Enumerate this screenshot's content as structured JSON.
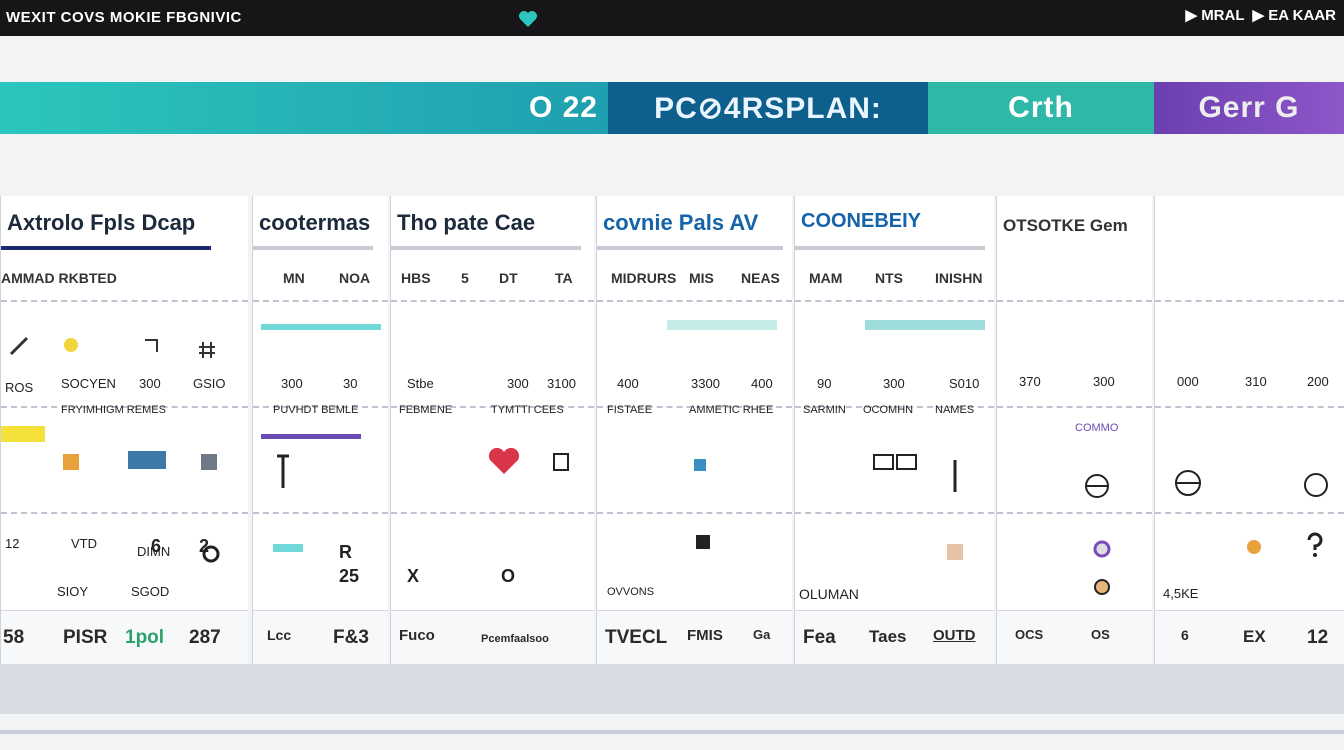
{
  "topbar": {
    "title": "WEXIT COVS MOKIE FBGNIVIC",
    "right_a": "▶ MRAL",
    "right_b": "▶ EA KAAR"
  },
  "ribbon": {
    "seg1": "O 22",
    "seg2": "PC⊘4RSPLAN:",
    "seg3": "Crth",
    "seg4": "Gerr G"
  },
  "colors": {
    "teal": "#2bc6bb",
    "navy": "#0e5f8c",
    "purple": "#7a4bbd"
  },
  "panels": [
    {
      "title": "Axtrolo Fpls Dcap",
      "cols": [
        "AMMAD RKBTED"
      ],
      "row1": [
        "ROS",
        "SOCYEN",
        "300",
        "GSIO"
      ],
      "row2": [
        "FRYIMHIGM REMES"
      ],
      "row3": [
        "12",
        "VTD",
        "DIMN"
      ],
      "row4": [
        "SIOY",
        "SGOD",
        "2",
        "6"
      ],
      "footer": [
        "58",
        "PISR",
        "1pol",
        "287"
      ]
    },
    {
      "title": "cootermas",
      "cols": [
        "MN",
        "NOA"
      ],
      "row1": [
        "300",
        "30"
      ],
      "row2": [
        "PUVHDT BEMLE"
      ],
      "row4": [
        "R",
        "25"
      ],
      "footer": [
        "Lcc",
        "F&3"
      ]
    },
    {
      "title": "Tho pate Cae",
      "cols": [
        "HBS",
        "5",
        "DT",
        "TA"
      ],
      "row1": [
        "Stbe",
        "300",
        "3100"
      ],
      "row2": [
        "FEBMENE",
        "TYMTTI CEES"
      ],
      "row4": [
        "X",
        "O"
      ],
      "footer": [
        "Fuco",
        "Pcemfaalsoo"
      ]
    },
    {
      "title": "covnie Pals AV",
      "cols": [
        "MIDRURS",
        "MIS",
        "NEAS"
      ],
      "row1": [
        "400",
        "3300",
        "400"
      ],
      "row2": [
        "FISTAEE",
        "AMMETIC RHEE"
      ],
      "row4": [
        "OVVONS"
      ],
      "footer": [
        "TVECL",
        "FMIS",
        "Ga"
      ]
    },
    {
      "title": "COONEBEIY",
      "cols": [
        "MAM",
        "NTS",
        "INISHN"
      ],
      "row1": [
        "90",
        "300",
        "S010"
      ],
      "row2": [
        "SARMIN",
        "OCOMHN",
        "NAMES"
      ],
      "row4": [
        "OLUMAN"
      ],
      "footer": [
        "Fea",
        "Taes",
        "OUTD"
      ]
    },
    {
      "title": "OTSOTKE Gem",
      "cols": [
        "",
        ""
      ],
      "row1": [
        "370",
        "300"
      ],
      "row2": [
        "COMMO"
      ],
      "row4": [
        "",
        ""
      ],
      "footer": [
        "OCS",
        "OS"
      ]
    },
    {
      "title": "",
      "cols": [],
      "row1": [
        "000",
        "310",
        "200"
      ],
      "row2": [],
      "row4": [
        "4,5KE"
      ],
      "footer": [
        "6",
        "EX",
        "12"
      ]
    }
  ]
}
